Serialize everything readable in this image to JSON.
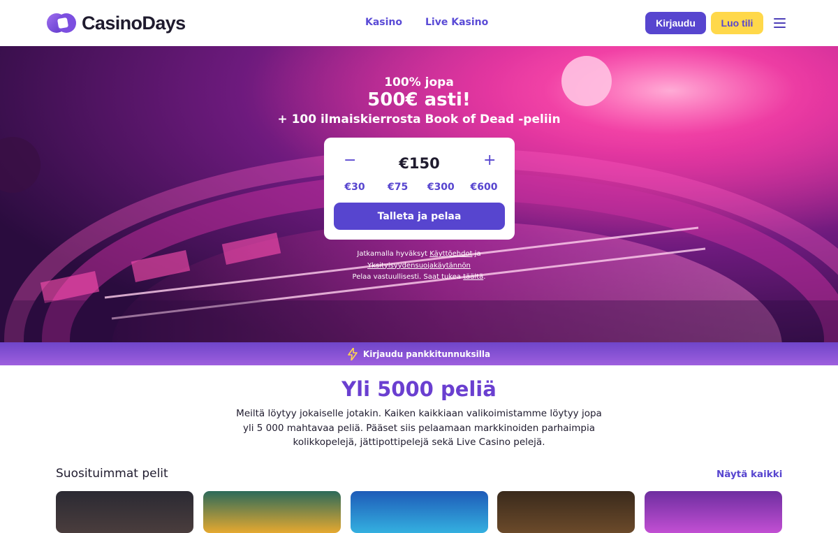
{
  "header": {
    "logo_text": "CasinoDays",
    "nav": [
      {
        "label": "Kasino"
      },
      {
        "label": "Live Kasino"
      }
    ],
    "login_label": "Kirjaudu",
    "register_label": "Luo tili",
    "menu_icon": "hamburger-icon"
  },
  "hero": {
    "line1": "100% jopa",
    "line2": "500€ asti!",
    "line3": "+ 100 ilmaiskierrosta Book of Dead -peliin",
    "deposit": {
      "amount": "€150",
      "minus": "−",
      "plus": "+",
      "presets": [
        "€30",
        "€75",
        "€300",
        "€600"
      ],
      "cta": "Talleta ja pelaa"
    },
    "terms": {
      "line1_prefix": "Jatkamalla hyväksyt ",
      "terms_link": "Käyttöehdot",
      "line1_suffix": " ja",
      "privacy_link": "Yksityisyydensuojakäytännön",
      "line3_prefix": "Pelaa vastuullisesti. Saat tukea ",
      "help_link": "täältä",
      "line3_suffix": "."
    }
  },
  "bank_login": {
    "icon": "lightning-icon",
    "label": "Kirjaudu pankkitunnuksilla"
  },
  "games_section": {
    "title": "Yli 5000 peliä",
    "description": "Meiltä löytyy jokaiselle jotakin. Kaiken kaikkiaan valikoimistamme löytyy jopa yli 5 000 mahtavaa peliä. Pääset siis pelaamaan markkinoiden parhaimpia kolikkopelejä, jättipottipelejä sekä Live Casino pelejä.",
    "popular_title": "Suosituimmat pelit",
    "show_all": "Näytä kaikki"
  },
  "colors": {
    "brand_purple": "#5745cf",
    "brand_yellow": "#ffd84a",
    "title_purple": "#6a3fd0"
  }
}
